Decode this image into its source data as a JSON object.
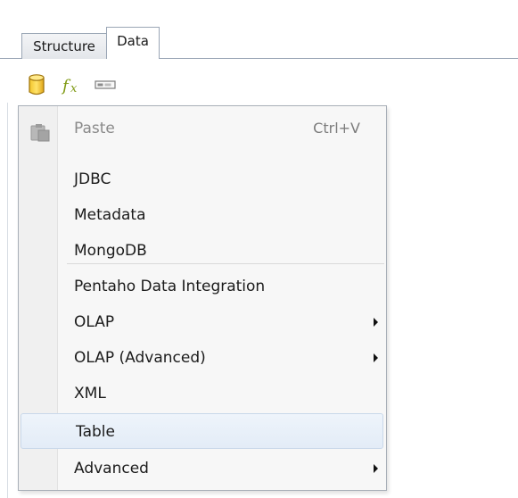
{
  "tabs": [
    {
      "label": "Structure",
      "active": false
    },
    {
      "label": "Data",
      "active": true
    }
  ],
  "toolbar": {
    "icons": [
      "database-icon",
      "fx-function-icon",
      "field-icon"
    ]
  },
  "menu": {
    "paste": {
      "label": "Paste",
      "shortcut": "Ctrl+V",
      "disabled": true,
      "icon": "paste-icon"
    },
    "items": [
      {
        "label": "JDBC",
        "submenu": false
      },
      {
        "label": "Metadata",
        "submenu": false
      },
      {
        "label": "MongoDB",
        "submenu": false
      },
      {
        "label": "Pentaho Data Integration",
        "submenu": false
      },
      {
        "label": "OLAP",
        "submenu": true
      },
      {
        "label": "OLAP (Advanced)",
        "submenu": true
      },
      {
        "label": "XML",
        "submenu": false
      },
      {
        "label": "Table",
        "submenu": false,
        "highlighted": true
      },
      {
        "label": "Advanced",
        "submenu": true
      }
    ]
  },
  "colors": {
    "menu_bg": "#f7f7f7",
    "highlight": "#e3ecf7",
    "border": "#a8afb8",
    "text": "#1b1b1b",
    "disabled_text": "#8a8a8a"
  }
}
